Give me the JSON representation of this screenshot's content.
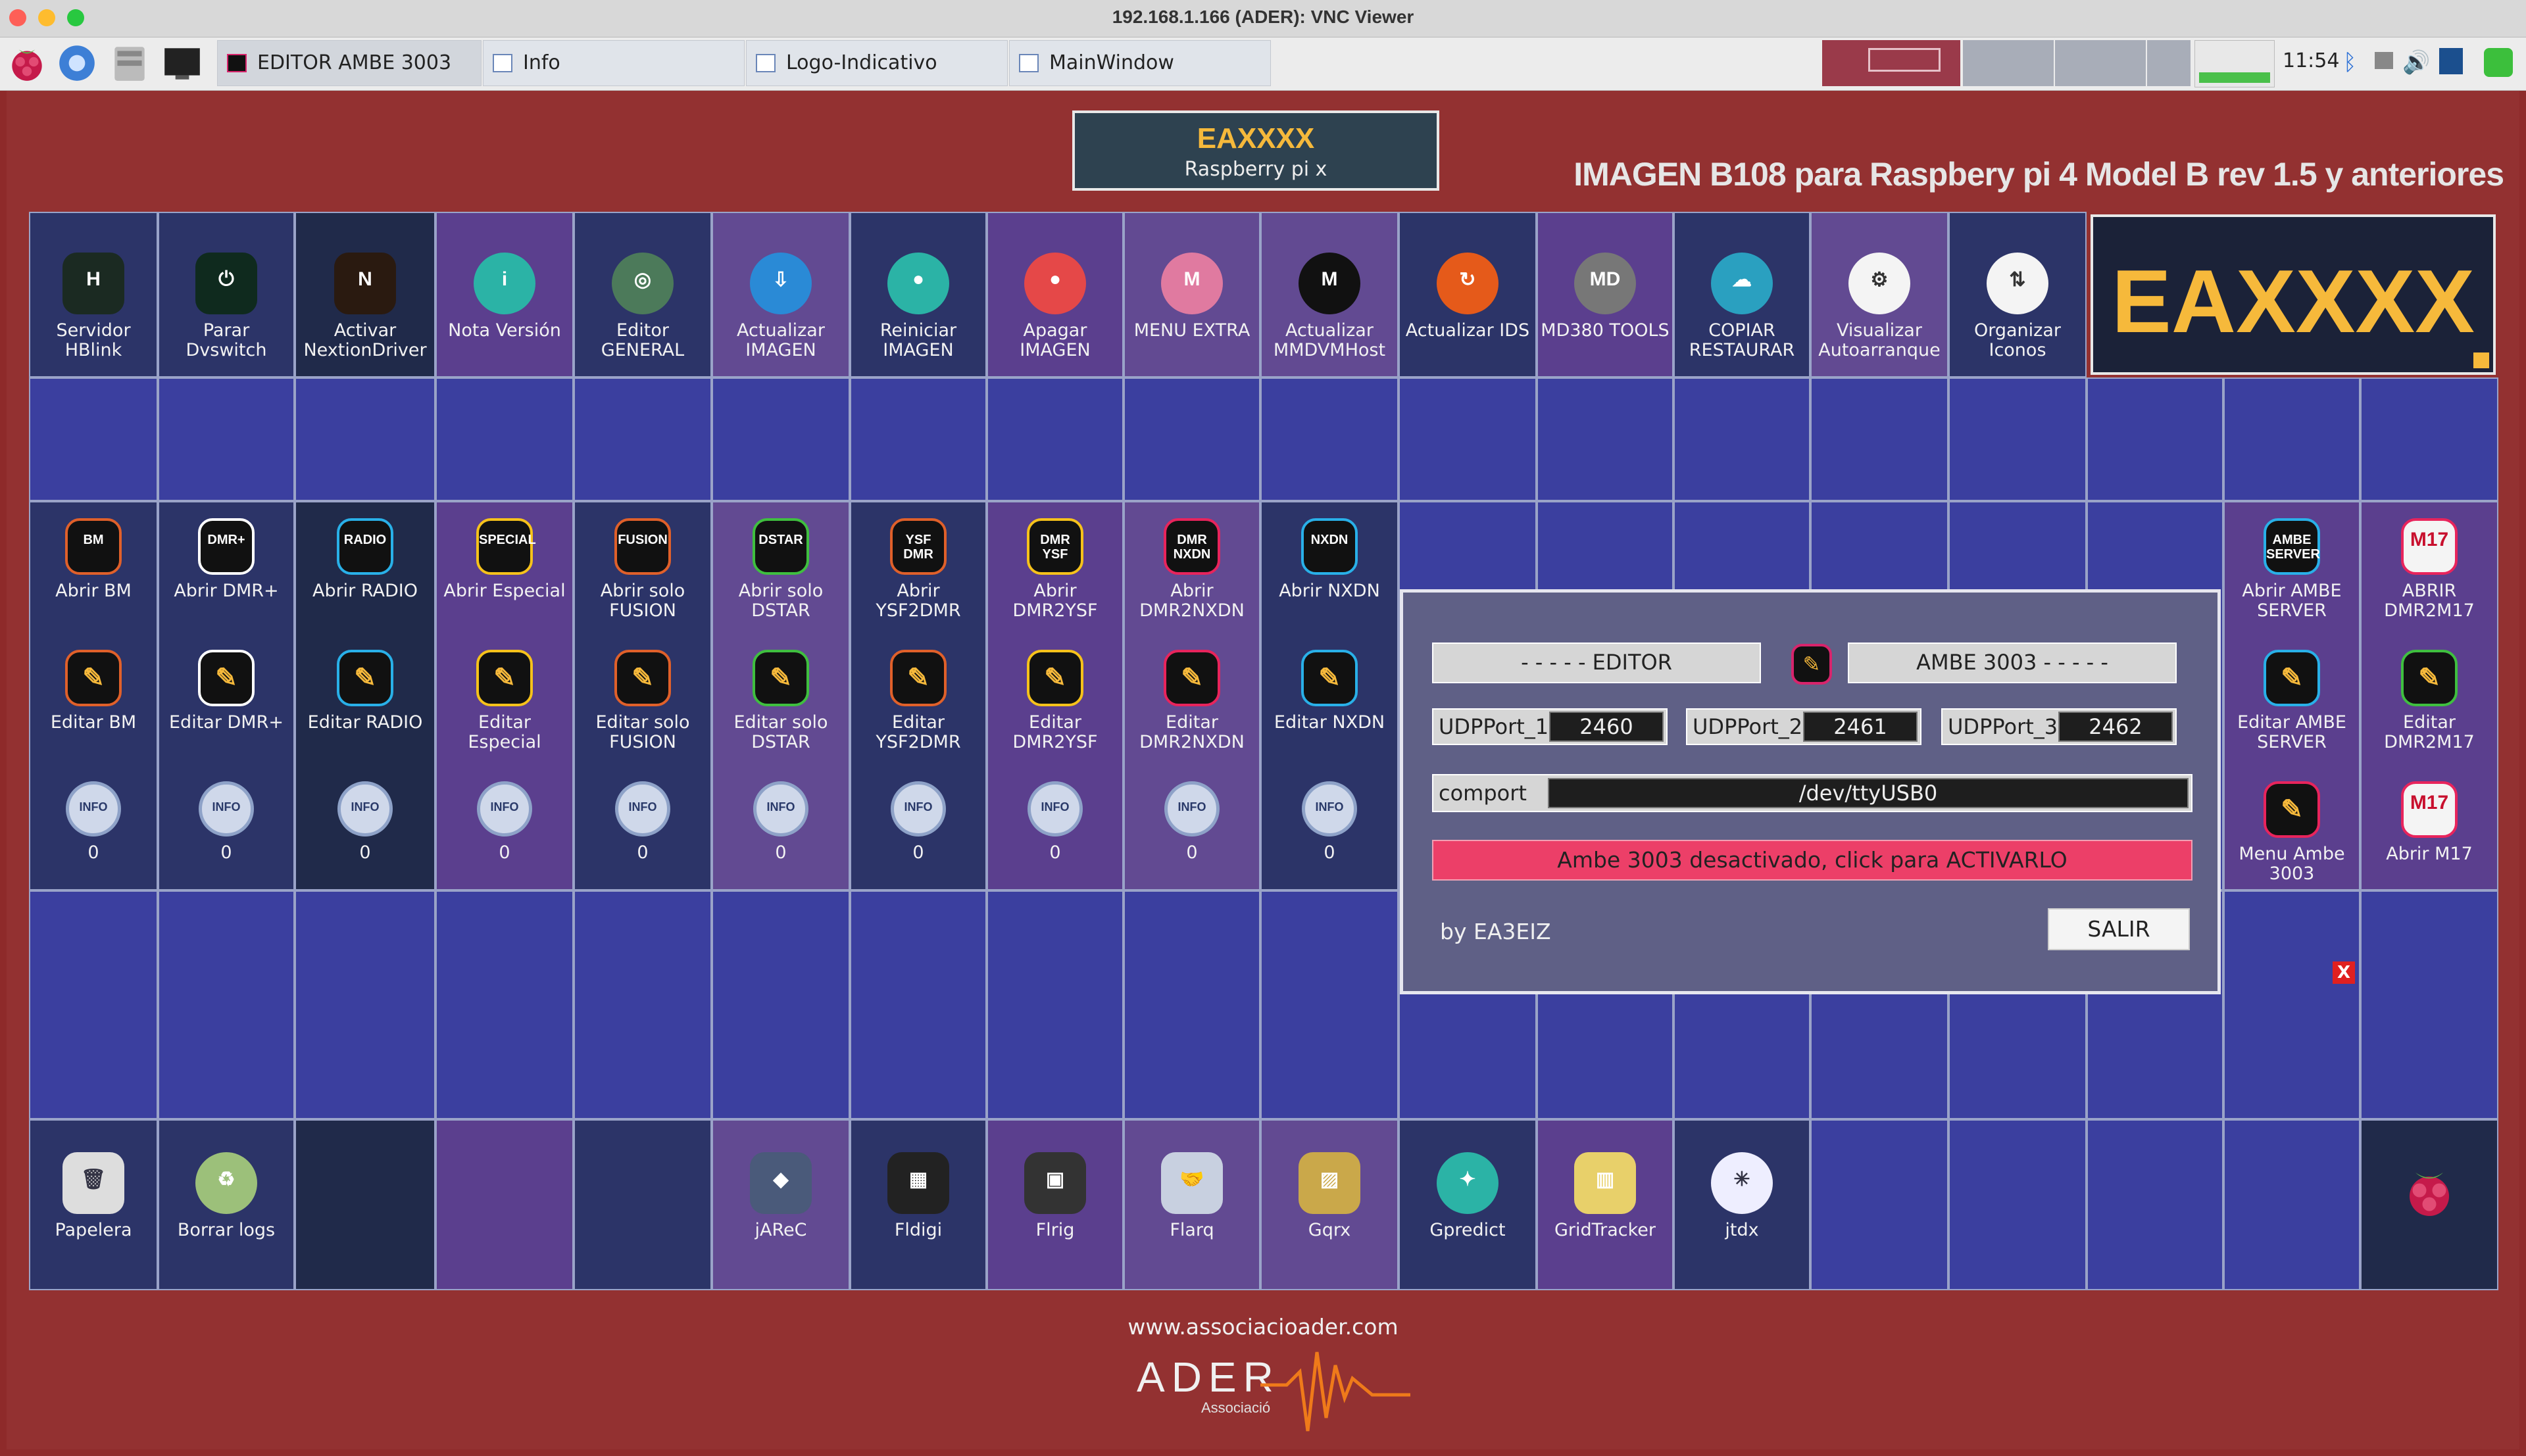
{
  "window": {
    "title": "192.168.1.166 (ADER): VNC Viewer"
  },
  "taskbar": {
    "windows": [
      {
        "label": "EDITOR AMBE 3003",
        "active": true
      },
      {
        "label": "Info",
        "active": false
      },
      {
        "label": "Logo-Indicativo",
        "active": false
      },
      {
        "label": "MainWindow",
        "active": false
      }
    ],
    "clock": "11:54"
  },
  "header": {
    "callsign": "EAXXXX",
    "device": "Raspberry pi x",
    "image_title": "IMAGEN B108 para Raspbery pi 4 Model B rev 1.5 y anteriores"
  },
  "top_row": [
    {
      "label": "Servidor\nHBlink",
      "icon": "hblink-icon"
    },
    {
      "label": "Parar\nDvswitch",
      "icon": "dvswitch-icon"
    },
    {
      "label": "Activar\nNextionDriver",
      "icon": "nextion-icon"
    },
    {
      "label": "Nota Versión",
      "icon": "info-icon"
    },
    {
      "label": "Editor\nGENERAL",
      "icon": "editor-icon"
    },
    {
      "label": "Actualizar\nIMAGEN",
      "icon": "download-icon"
    },
    {
      "label": "Reiniciar\nIMAGEN",
      "icon": "toggle-on-icon"
    },
    {
      "label": "Apagar\nIMAGEN",
      "icon": "toggle-off-icon"
    },
    {
      "label": "MENU EXTRA",
      "icon": "menu-extra-icon"
    },
    {
      "label": "Actualizar\nMMDVMHost",
      "icon": "mmdvm-icon"
    },
    {
      "label": "Actualizar IDS",
      "icon": "refresh-icon"
    },
    {
      "label": "MD380 TOOLS",
      "icon": "md380-icon"
    },
    {
      "label": "COPIAR\nRESTAURAR",
      "icon": "cloud-icon"
    },
    {
      "label": "Visualizar\nAutoarranque",
      "icon": "gear-icon"
    },
    {
      "label": "Organizar\nIconos",
      "icon": "sort-icon"
    }
  ],
  "big_callsign": "EAXXXX",
  "modes": [
    {
      "open": "Abrir BM",
      "edit": "Editar BM",
      "info": "0",
      "tag": "BM",
      "color": "#e0602a"
    },
    {
      "open": "Abrir DMR+",
      "edit": "Editar DMR+",
      "info": "0",
      "tag": "DMR+",
      "color": "#ffffff"
    },
    {
      "open": "Abrir RADIO",
      "edit": "Editar RADIO",
      "info": "0",
      "tag": "RADIO",
      "color": "#29b0e8"
    },
    {
      "open": "Abrir Especial",
      "edit": "Editar\nEspecial",
      "info": "0",
      "tag": "SPECIAL",
      "color": "#f6c21b"
    },
    {
      "open": "Abrir solo\nFUSION",
      "edit": "Editar solo\nFUSION",
      "info": "0",
      "tag": "FUSION",
      "color": "#e0602a"
    },
    {
      "open": "Abrir solo\nDSTAR",
      "edit": "Editar solo\nDSTAR",
      "info": "0",
      "tag": "DSTAR",
      "color": "#3fbf3f"
    },
    {
      "open": "Abrir\nYSF2DMR",
      "edit": "Editar\nYSF2DMR",
      "info": "0",
      "tag": "YSF\nDMR",
      "color": "#e0602a"
    },
    {
      "open": "Abrir\nDMR2YSF",
      "edit": "Editar\nDMR2YSF",
      "info": "0",
      "tag": "DMR\nYSF",
      "color": "#f6c21b"
    },
    {
      "open": "Abrir\nDMR2NXDN",
      "edit": "Editar\nDMR2NXDN",
      "info": "0",
      "tag": "DMR\nNXDN",
      "color": "#e8245c"
    },
    {
      "open": "Abrir NXDN",
      "edit": "Editar NXDN",
      "info": "0",
      "tag": "NXDN",
      "color": "#29b0e8"
    }
  ],
  "right_column": {
    "ambe": [
      {
        "label": "Abrir AMBE\nSERVER",
        "tag": "AMBE\nSERVER"
      },
      {
        "label": "Editar AMBE\nSERVER"
      },
      {
        "label": "Menu Ambe\n3003"
      }
    ],
    "m17": [
      {
        "label": "ABRIR\nDMR2M17",
        "tag": "M17"
      },
      {
        "label": "Editar\nDMR2M17"
      },
      {
        "label": "Abrir M17",
        "tag": "M17"
      }
    ],
    "close_label": "X"
  },
  "dialog": {
    "editor_label": "- - - - -    EDITOR",
    "ambe_label": "AMBE 3003    - - - - -",
    "udp": [
      {
        "label": "UDPPort_1",
        "value": "2460"
      },
      {
        "label": "UDPPort_2",
        "value": "2461"
      },
      {
        "label": "UDPPort_3",
        "value": "2462"
      }
    ],
    "comport_label": "comport",
    "comport_value": "/dev/ttyUSB0",
    "status": "Ambe 3003 desactivado, click para ACTIVARLO",
    "author": "by EA3EIZ",
    "exit": "SALIR"
  },
  "bottom_row": [
    {
      "label": "Papelera",
      "icon": "trash-icon"
    },
    {
      "label": "Borrar logs",
      "icon": "bin-icon"
    },
    {
      "label": "jAReC",
      "icon": "jarec-icon"
    },
    {
      "label": "Fldigi",
      "icon": "fldigi-icon"
    },
    {
      "label": "Flrig",
      "icon": "flrig-icon"
    },
    {
      "label": "Flarq",
      "icon": "handshake-icon"
    },
    {
      "label": "Gqrx",
      "icon": "gqrx-icon"
    },
    {
      "label": "Gpredict",
      "icon": "satellite-icon"
    },
    {
      "label": "GridTracker",
      "icon": "gridtracker-icon"
    },
    {
      "label": "jtdx",
      "icon": "compass-icon"
    }
  ],
  "footer": {
    "url": "www.associacioader.com",
    "logo_text": "ADER",
    "logo_sub": "Associació"
  }
}
